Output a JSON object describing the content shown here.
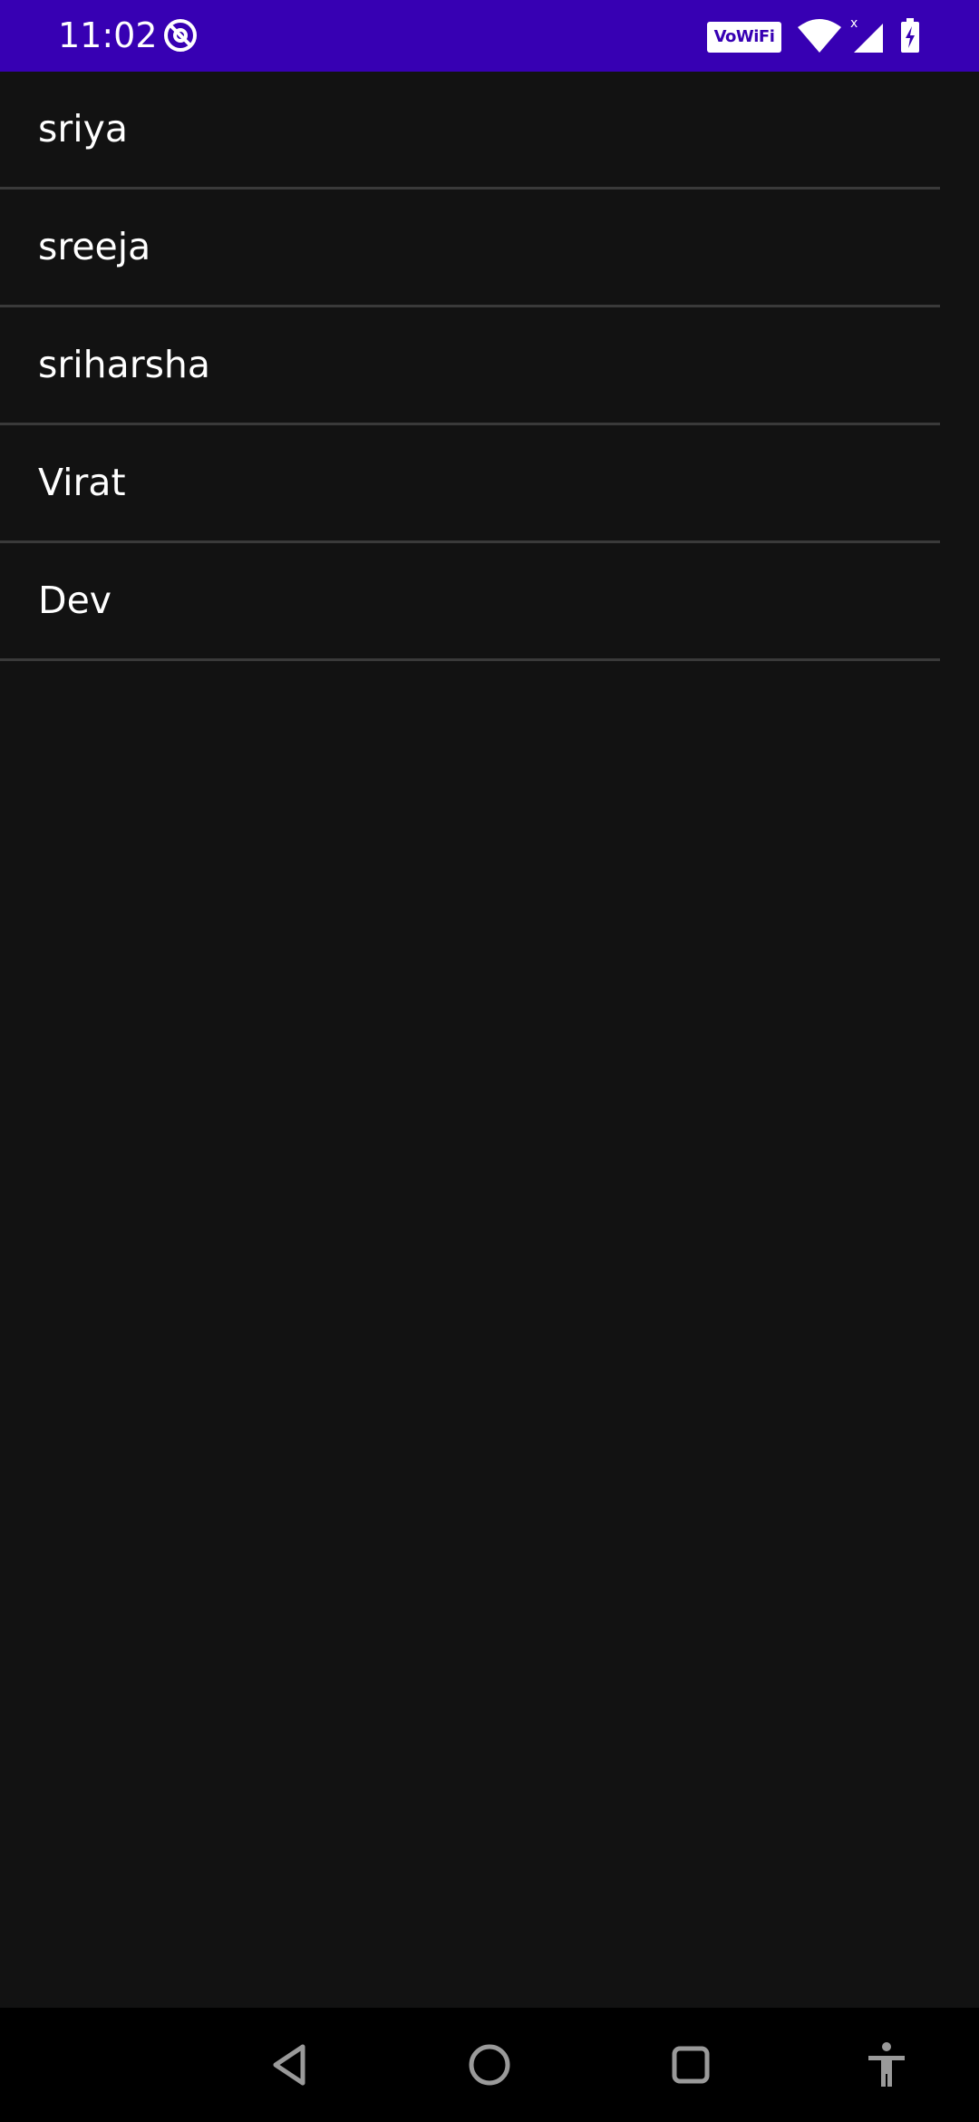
{
  "status_bar": {
    "time": "11:02",
    "vowifi_label": "VoWiFi",
    "background_color": "#3700b3",
    "icons": [
      "sync-off-icon",
      "wifi-icon",
      "cell-signal-icon",
      "battery-charging-icon"
    ]
  },
  "list": {
    "items": [
      {
        "label": "sriya"
      },
      {
        "label": "sreeja"
      },
      {
        "label": "sriharsha"
      },
      {
        "label": "Virat"
      },
      {
        "label": "Dev"
      }
    ],
    "divider_color": "#3a3a3a"
  },
  "nav_bar": {
    "icons": [
      "back-icon",
      "home-icon",
      "recents-icon",
      "accessibility-icon"
    ]
  }
}
